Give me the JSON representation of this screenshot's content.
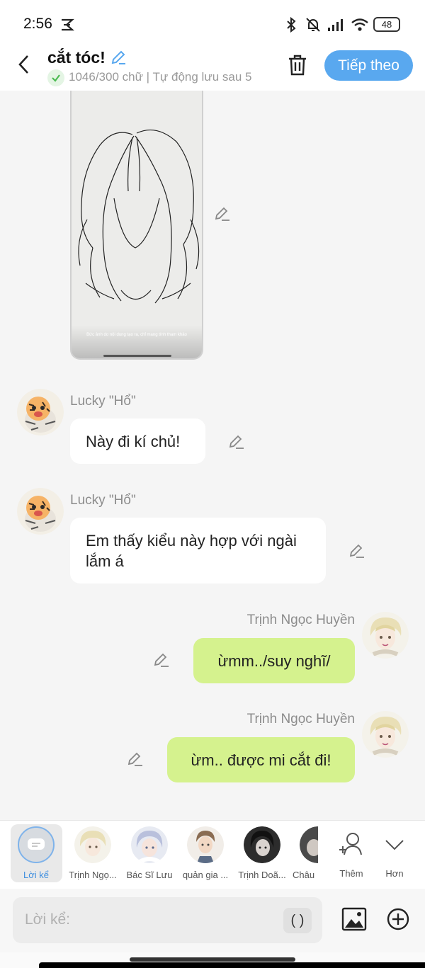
{
  "status_bar": {
    "time": "2:56",
    "battery": "48"
  },
  "header": {
    "title": "cắt tóc!",
    "subtitle": "1046/300 chữ | Tự động lưu sau 5",
    "next_label": "Tiếp theo"
  },
  "image_card": {
    "caption": "Bức ảnh do nội dung tạo ra, chỉ mang tính tham khảo"
  },
  "messages": [
    {
      "name": "Lucky \"Hổ\"",
      "text": "Này đi kí chủ!",
      "side": "left"
    },
    {
      "name": "Lucky \"Hổ\"",
      "text": "Em thấy kiểu này hợp với ngài lắm á",
      "side": "left"
    },
    {
      "name": "Trịnh Ngọc Huyền",
      "text": "ừmm../suy nghĩ/",
      "side": "right"
    },
    {
      "name": "Trịnh Ngọc Huyền",
      "text": "ừm.. được mi cắt đi!",
      "side": "right"
    }
  ],
  "characters": [
    {
      "label": "Lời kể",
      "selected": true
    },
    {
      "label": "Trịnh Ngọ..."
    },
    {
      "label": "Bác Sĩ Lưu"
    },
    {
      "label": "quản gia ..."
    },
    {
      "label": "Trịnh Doã..."
    },
    {
      "label": "Châu"
    },
    {
      "label": "Thêm"
    },
    {
      "label": "Hơn"
    }
  ],
  "input": {
    "placeholder": "Lời kể:",
    "paren_label": "( )"
  },
  "colors": {
    "accent": "#59a8ef",
    "out_bubble": "#d5f28e",
    "narration_circle": "#9cc7ee"
  }
}
